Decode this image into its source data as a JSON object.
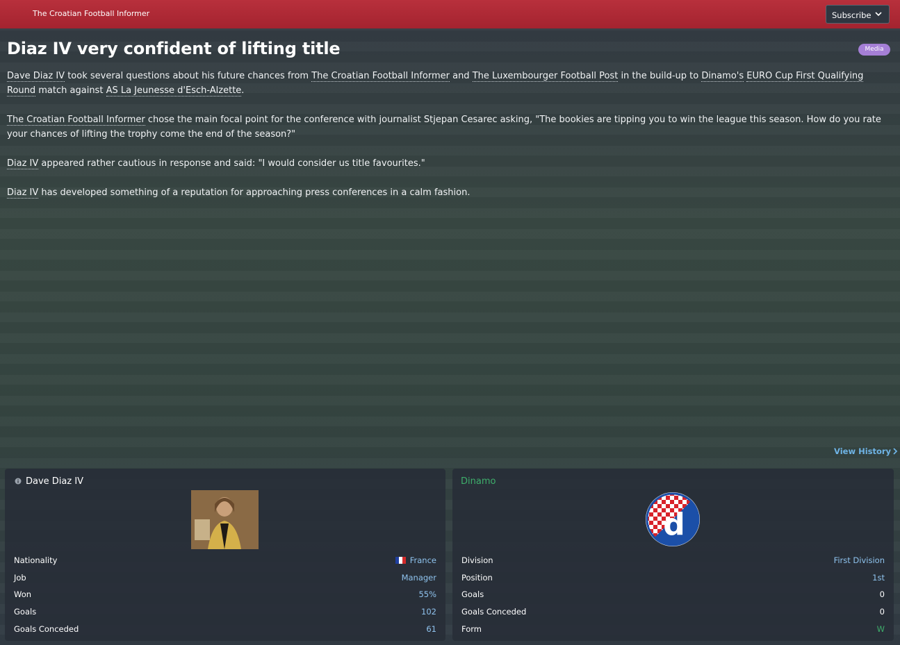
{
  "topbar": {
    "publication": "The Croatian Football Informer",
    "subscribe_label": "Subscribe"
  },
  "article": {
    "headline": "Diaz IV very confident of lifting title",
    "badge": "Media",
    "p1": {
      "l1": "Dave Diaz IV",
      "t1": " took several questions about his future chances from ",
      "l2": "The Croatian Football Informer",
      "t2": " and ",
      "l3": "The Luxembourger Football Post",
      "t3": " in the build-up to ",
      "l4": "Dinamo's",
      "t4": " ",
      "l5": "EURO Cup First Qualifying Round",
      "t5": " match against ",
      "l6": "AS La Jeunesse d'Esch-Alzette",
      "t6": "."
    },
    "p2": {
      "l1": "The Croatian Football Informer",
      "t1": " chose the main focal point for the conference with journalist Stjepan Cesarec asking, \"The bookies are tipping you to win the league this season. How do you rate your chances of lifting the trophy come the end of the season?\""
    },
    "p3": {
      "l1": "Diaz IV",
      "t1": " appeared rather cautious in response and said: \"I would consider us title favourites.\""
    },
    "p4": {
      "l1": "Diaz IV",
      "t1": " has developed something of a reputation for approaching press conferences in a calm fashion."
    }
  },
  "view_history": "View History",
  "person_panel": {
    "name": "Dave Diaz IV",
    "rows": [
      {
        "label": "Nationality",
        "value": "France"
      },
      {
        "label": "Job",
        "value": "Manager"
      },
      {
        "label": "Won",
        "value": "55%"
      },
      {
        "label": "Goals",
        "value": "102"
      },
      {
        "label": "Goals Conceded",
        "value": "61"
      }
    ]
  },
  "club_panel": {
    "name": "Dinamo",
    "crest_letter": "d",
    "rows": [
      {
        "label": "Division",
        "value": "First Division"
      },
      {
        "label": "Position",
        "value": "1st"
      },
      {
        "label": "Goals",
        "value": "0"
      },
      {
        "label": "Goals Conceded",
        "value": "0"
      },
      {
        "label": "Form",
        "value": "W"
      }
    ]
  },
  "colors": {
    "topbar": "#a4232f",
    "link": "#8fc3ee",
    "club_green": "#3eae6b",
    "badge": "#a57fd6"
  }
}
